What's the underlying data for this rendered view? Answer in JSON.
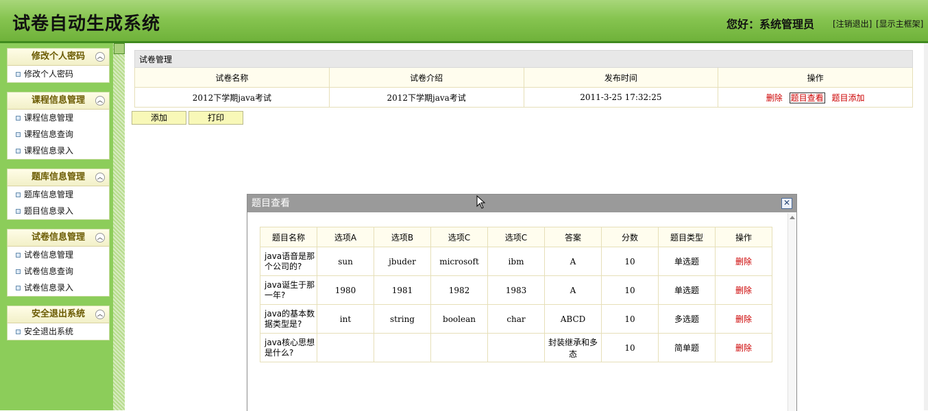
{
  "header": {
    "title": "试卷自动生成系统",
    "greeting": "您好：系统管理员",
    "logout_link": "[注销退出]",
    "show_frame_link": "[显示主框架]"
  },
  "sidebar": {
    "groups": [
      {
        "title": "修改个人密码",
        "items": [
          "修改个人密码"
        ]
      },
      {
        "title": "课程信息管理",
        "items": [
          "课程信息管理",
          "课程信息查询",
          "课程信息录入"
        ]
      },
      {
        "title": "题库信息管理",
        "items": [
          "题库信息管理",
          "题目信息录入"
        ]
      },
      {
        "title": "试卷信息管理",
        "items": [
          "试卷信息管理",
          "试卷信息查询",
          "试卷信息录入"
        ]
      },
      {
        "title": "安全退出系统",
        "items": [
          "安全退出系统"
        ]
      }
    ],
    "collapse_icon": "chevron-up-icon"
  },
  "main": {
    "caption": "试卷管理",
    "columns": [
      "试卷名称",
      "试卷介绍",
      "发布时间",
      "操作"
    ],
    "rows": [
      {
        "name": "2012下学期java考试",
        "intro": "2012下学期java考试",
        "time": "2011-3-25 17:32:25",
        "actions": [
          "删除",
          "题目查看",
          "题目添加"
        ]
      }
    ],
    "buttons": {
      "add": "添加",
      "print": "打印"
    }
  },
  "dialog": {
    "title": "题目查看",
    "close_icon": "close-icon",
    "columns": [
      "题目名称",
      "选项A",
      "选项B",
      "选项C",
      "选项C",
      "答案",
      "分数",
      "题目类型",
      "操作"
    ],
    "rows": [
      {
        "name": "java语音是那个公司的?",
        "a": "sun",
        "b": "jbuder",
        "c": "microsoft",
        "d": "ibm",
        "answer": "A",
        "score": "10",
        "type": "单选题",
        "op": "删除"
      },
      {
        "name": "java诞生于那一年?",
        "a": "1980",
        "b": "1981",
        "c": "1982",
        "d": "1983",
        "answer": "A",
        "score": "10",
        "type": "单选题",
        "op": "删除"
      },
      {
        "name": "java的基本数据类型是?",
        "a": "int",
        "b": "string",
        "c": "boolean",
        "d": "char",
        "answer": "ABCD",
        "score": "10",
        "type": "多选题",
        "op": "删除"
      },
      {
        "name": "java核心思想是什么?",
        "a": "",
        "b": "",
        "c": "",
        "d": "",
        "answer": "封装继承和多态",
        "score": "10",
        "type": "简单题",
        "op": "删除"
      }
    ]
  },
  "colors": {
    "header_green": "#86c450",
    "sidebar_green": "#8ccd5a",
    "action_red": "#cc0000"
  }
}
